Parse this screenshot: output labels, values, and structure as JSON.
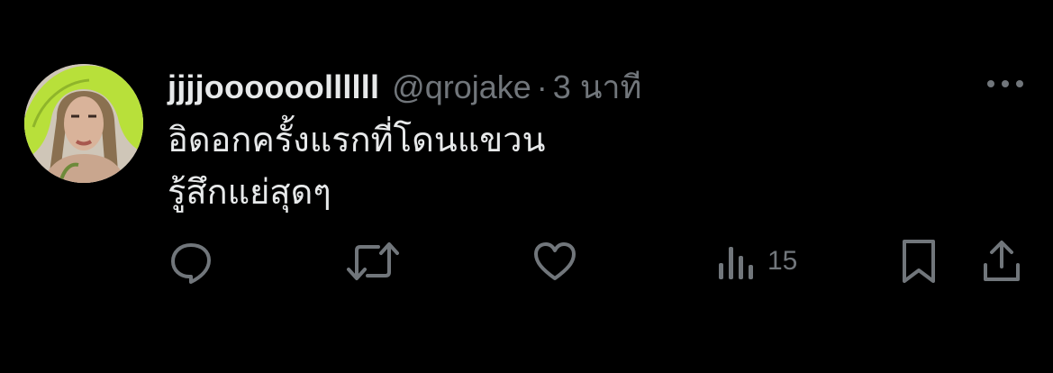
{
  "tweet": {
    "display_name": "jjjjoooooollllll",
    "handle": "@qrojake",
    "separator": "·",
    "time": "3 นาที",
    "body_lines": [
      "อิดอกครั้งแรกที่โดนแขวน",
      "รู้สึกแย่สุดๆ"
    ]
  },
  "actions": {
    "views": "15"
  },
  "icons": [
    "more-icon",
    "reply-icon",
    "retweet-icon",
    "like-icon",
    "views-icon",
    "bookmark-icon",
    "share-icon"
  ],
  "colors": {
    "background": "#000000",
    "primary_text": "#e7e9ea",
    "secondary_text": "#71767b",
    "avatar_hood": "#b8e03a"
  }
}
